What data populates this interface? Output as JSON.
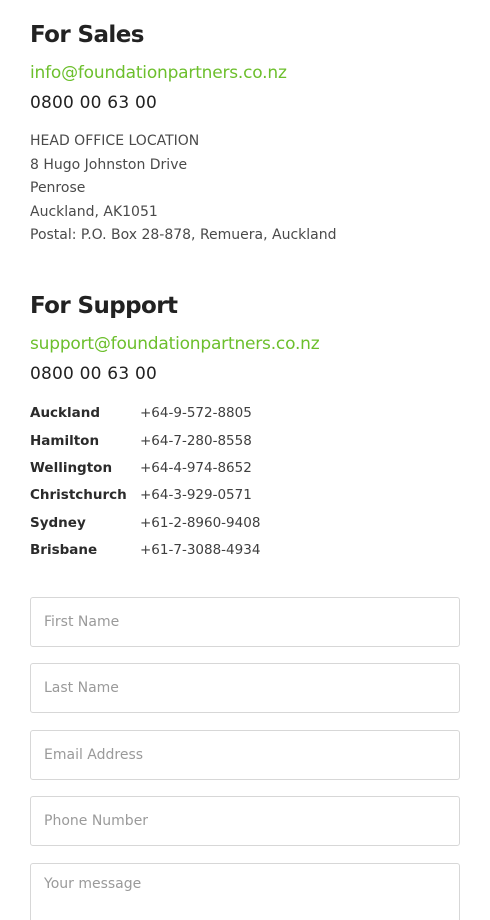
{
  "sales": {
    "heading": "For Sales",
    "email": "info@foundationpartners.co.nz",
    "phone": "0800 00 63 00",
    "address": {
      "label": "HEAD OFFICE LOCATION",
      "street": "8 Hugo Johnston Drive",
      "suburb": "Penrose",
      "city": "Auckland, AK1051",
      "postal": "Postal: P.O. Box 28-878, Remuera, Auckland"
    }
  },
  "support": {
    "heading": "For Support",
    "email": "support@foundationpartners.co.nz",
    "phone": "0800 00 63 00",
    "offices": [
      {
        "city": "Auckland",
        "phone": "+64-9-572-8805"
      },
      {
        "city": "Hamilton",
        "phone": "+64-7-280-8558"
      },
      {
        "city": "Wellington",
        "phone": "+64-4-974-8652"
      },
      {
        "city": "Christchurch",
        "phone": "+64-3-929-0571"
      },
      {
        "city": "Sydney",
        "phone": "+61-2-8960-9408"
      },
      {
        "city": "Brisbane",
        "phone": "+61-7-3088-4934"
      }
    ]
  },
  "form": {
    "first_name": {
      "placeholder": "First Name",
      "value": ""
    },
    "last_name": {
      "placeholder": "Last Name",
      "value": ""
    },
    "email": {
      "placeholder": "Email Address",
      "value": ""
    },
    "phone": {
      "placeholder": "Phone Number",
      "value": ""
    },
    "message": {
      "placeholder": "Your message",
      "value": ""
    }
  },
  "colors": {
    "accent": "#6cbf2c",
    "heading": "#222222",
    "border": "#d7d7d7"
  }
}
